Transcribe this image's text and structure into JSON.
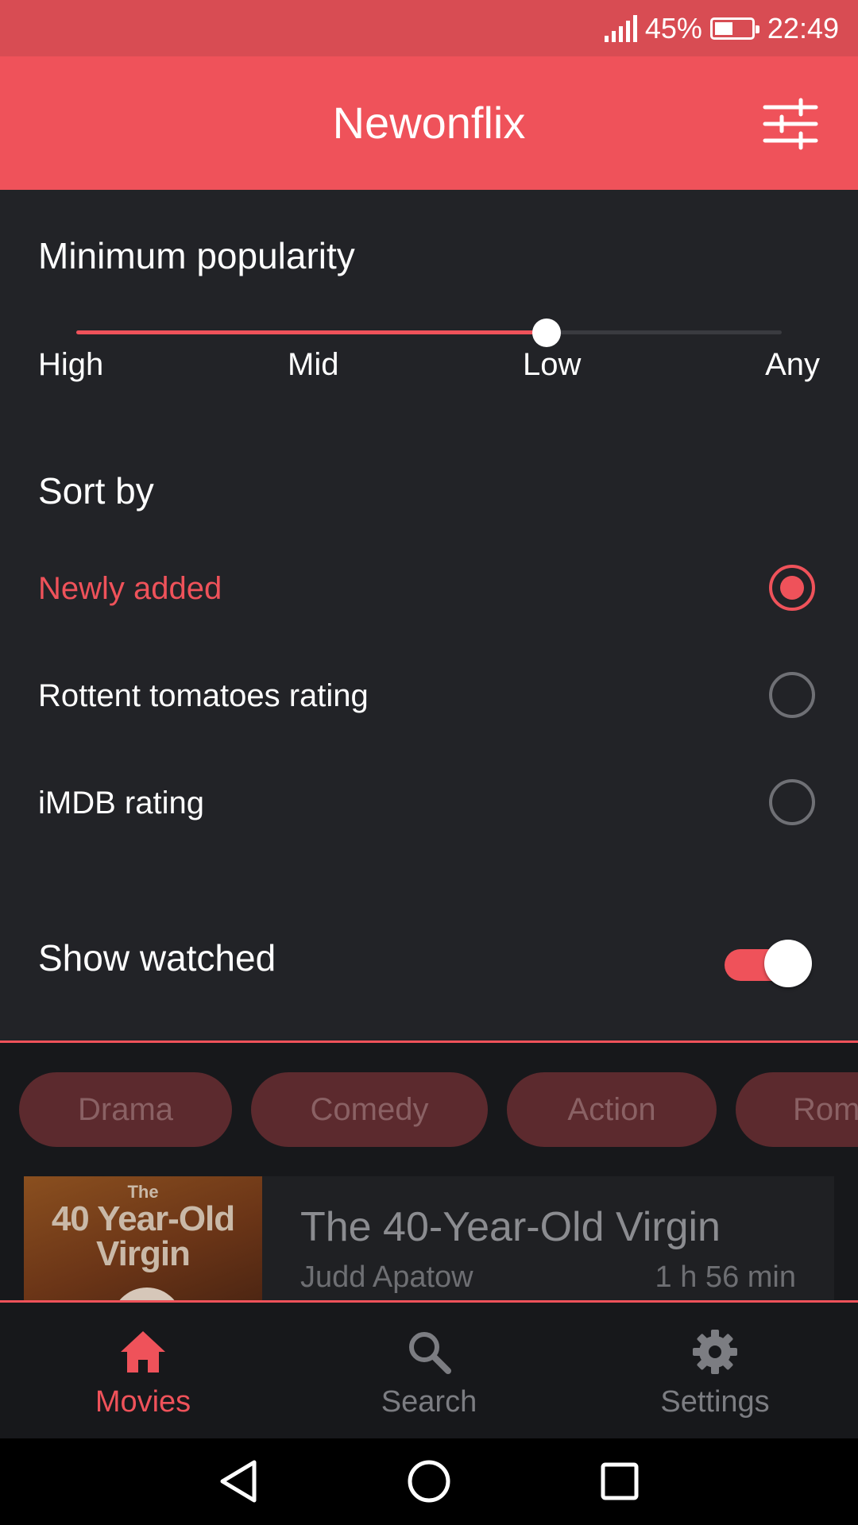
{
  "status_bar": {
    "signal_icon": "signal-bars-icon",
    "battery_percent": "45%",
    "battery_icon": "battery-icon",
    "time": "22:49"
  },
  "app_bar": {
    "title": "Newonflix",
    "filter_icon": "sliders-icon"
  },
  "filters": {
    "popularity": {
      "title": "Minimum popularity",
      "ticks": [
        "High",
        "Mid",
        "Low",
        "Any"
      ],
      "selected": "Low",
      "selected_index": 2
    },
    "sort": {
      "title": "Sort by",
      "options": [
        {
          "label": "Newly added",
          "selected": true
        },
        {
          "label": "Rottent tomatoes rating",
          "selected": false
        },
        {
          "label": "iMDB rating",
          "selected": false
        }
      ]
    },
    "show_watched": {
      "label": "Show watched",
      "on": true
    }
  },
  "genres": [
    "Drama",
    "Comedy",
    "Action",
    "Rom"
  ],
  "movie": {
    "poster_small": "The",
    "poster_line1": "40 Year-Old",
    "poster_line2": "Virgin",
    "title": "The 40-Year-Old Virgin",
    "director": "Judd Apatow",
    "length": "1 h 56 min"
  },
  "bottom_nav": [
    {
      "label": "Movies",
      "icon": "home-icon",
      "active": true
    },
    {
      "label": "Search",
      "icon": "search-icon",
      "active": false
    },
    {
      "label": "Settings",
      "icon": "gear-icon",
      "active": false
    }
  ],
  "colors": {
    "accent": "#ef525a",
    "status_bar": "#d84c53",
    "panel": "#222327",
    "background": "#17181b",
    "chip": "#5c2a2e"
  }
}
